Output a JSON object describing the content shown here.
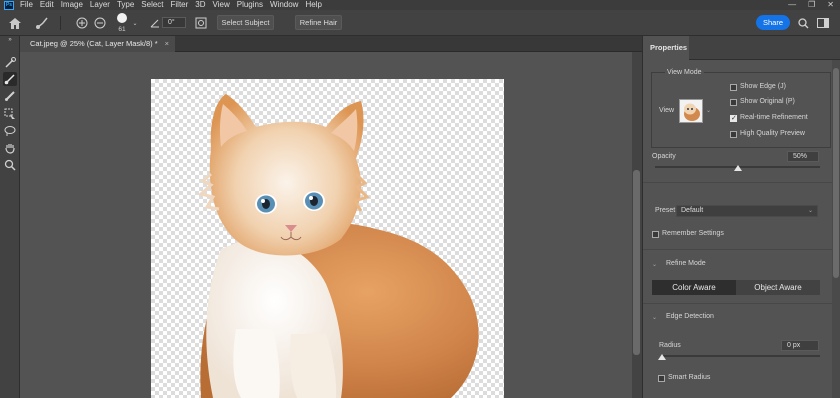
{
  "app": {
    "logo": "Ps"
  },
  "menu": [
    "File",
    "Edit",
    "Image",
    "Layer",
    "Type",
    "Select",
    "Filter",
    "3D",
    "View",
    "Plugins",
    "Window",
    "Help"
  ],
  "options_bar": {
    "brush_size": "61",
    "angle": "0°",
    "select_subject_label": "Select Subject",
    "refine_hair_label": "Refine Hair",
    "share_label": "Share",
    "accent_color": "#1473e6"
  },
  "document": {
    "tab_title": "Cat.jpeg @ 25% (Cat, Layer Mask/8) *",
    "close_glyph": "×"
  },
  "properties": {
    "tab_label": "Properties",
    "view_mode_heading": "View Mode",
    "view_label": "View",
    "show_edge": {
      "label": "Show Edge (J)",
      "checked": false
    },
    "show_original": {
      "label": "Show Original (P)",
      "checked": false
    },
    "realtime_refinement": {
      "label": "Real-time Refinement",
      "checked": true
    },
    "high_quality_preview": {
      "label": "High Quality Preview",
      "checked": false
    },
    "opacity_label": "Opacity",
    "opacity_value": "50%",
    "opacity_fraction": 0.5,
    "preset_label": "Preset",
    "preset_value": "Default",
    "remember_settings": {
      "label": "Remember Settings",
      "checked": false
    },
    "refine_mode_heading": "Refine Mode",
    "refine_mode_options": [
      "Color Aware",
      "Object Aware"
    ],
    "refine_mode_selected": 0,
    "edge_detection_heading": "Edge Detection",
    "radius_label": "Radius",
    "radius_value": "0 px",
    "radius_fraction": 0,
    "smart_radius": {
      "label": "Smart Radius",
      "checked": false
    }
  }
}
